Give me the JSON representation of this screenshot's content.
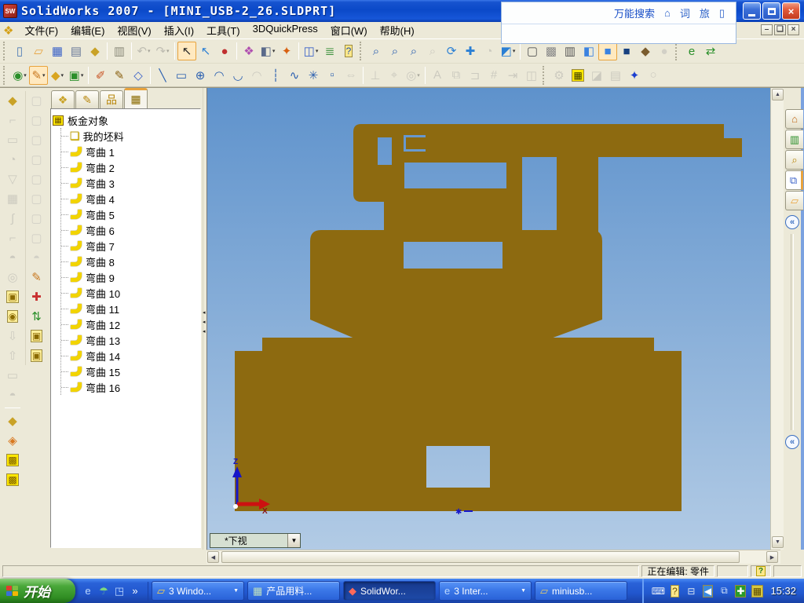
{
  "window": {
    "title": "SolidWorks 2007 - [MINI_USB-2_26.SLDPRT]",
    "close_glyph": "×",
    "mdi_min": "–",
    "mdi_restore": "❏",
    "mdi_close": "×"
  },
  "search_overlay": {
    "label": "万能搜索",
    "icons": [
      {
        "n": "home-icon",
        "g": "⌂"
      },
      {
        "n": "dictionary-icon",
        "g": "词"
      },
      {
        "n": "travel-icon",
        "g": "旅"
      },
      {
        "n": "page-icon",
        "g": "▯"
      }
    ]
  },
  "menu_bar": {
    "items": [
      "文件(F)",
      "编辑(E)",
      "视图(V)",
      "插入(I)",
      "工具(T)",
      "3DQuickPress",
      "窗口(W)",
      "帮助(H)"
    ]
  },
  "toolbars": {
    "row1": [
      {
        "grip": true
      },
      {
        "n": "new-doc-icon",
        "g": "▯",
        "c": "#4a7ab5"
      },
      {
        "n": "open-icon",
        "g": "▱",
        "c": "#e8a33d"
      },
      {
        "n": "save-icon",
        "g": "▦",
        "c": "#3b62c8"
      },
      {
        "n": "make-drawing-icon",
        "g": "▤",
        "c": "#6a7a9a"
      },
      {
        "n": "sw-explorer-icon",
        "g": "◆",
        "c": "#c9a227"
      },
      {
        "sep": true
      },
      {
        "n": "print-icon",
        "g": "▥",
        "c": "#8a8a7a"
      },
      {
        "sep": true
      },
      {
        "n": "undo-icon",
        "g": "↶",
        "c": "#777",
        "dis": true,
        "dd": true
      },
      {
        "n": "redo-icon",
        "g": "↷",
        "c": "#777",
        "dis": true,
        "dd": true
      },
      {
        "sep": true
      },
      {
        "n": "select-icon",
        "g": "↖",
        "c": "#222",
        "pr": true
      },
      {
        "n": "select-filter-icon",
        "g": "↖",
        "c": "#2a7fd4"
      },
      {
        "n": "filter-toggle-icon",
        "g": "●",
        "c": "#c03030"
      },
      {
        "sep": true
      },
      {
        "n": "color-swatch-icon",
        "g": "❖",
        "c": "#b050b0"
      },
      {
        "n": "section-view-icon",
        "g": "◧",
        "c": "#5a6a8a",
        "dd": true
      },
      {
        "n": "photoworks-icon",
        "g": "✦",
        "c": "#d86010"
      },
      {
        "sep": true
      },
      {
        "n": "window-split-icon",
        "g": "◫",
        "c": "#3b62c8",
        "dd": true
      },
      {
        "n": "options-icon",
        "g": "≣",
        "c": "#3a8f3a"
      },
      {
        "n": "help-icon",
        "g": "?",
        "c": "#1a50b0",
        "bg": "#ffe88a"
      },
      {
        "grip": true
      },
      {
        "n": "zoom-select-icon",
        "g": "⌕",
        "c": "#2a5fb0"
      },
      {
        "n": "zoom-fit-icon",
        "g": "⌕",
        "c": "#2a5fb0"
      },
      {
        "n": "zoom-area-icon",
        "g": "⌕",
        "c": "#2a5fb0"
      },
      {
        "n": "zoom-inout-icon",
        "g": "⌕",
        "c": "#999",
        "dis": true
      },
      {
        "n": "rotate-view-icon",
        "g": "⟳",
        "c": "#2a7fd4"
      },
      {
        "n": "pan-icon",
        "g": "✚",
        "c": "#2a7fd4"
      },
      {
        "n": "previous-view-icon",
        "g": "◔",
        "c": "#999",
        "dis": true
      },
      {
        "n": "view-orientation-icon",
        "g": "◩",
        "c": "#2a7fd4",
        "dd": true
      },
      {
        "sep": true
      },
      {
        "n": "wireframe-icon",
        "g": "▢",
        "c": "#555"
      },
      {
        "n": "hidden-lines-visible-icon",
        "g": "▩",
        "c": "#888"
      },
      {
        "n": "hidden-lines-removed-icon",
        "g": "▥",
        "c": "#555"
      },
      {
        "n": "shaded-with-edges-icon",
        "g": "◧",
        "c": "#3b82e0"
      },
      {
        "n": "shaded-icon",
        "g": "■",
        "c": "#3b82e0",
        "pr": true
      },
      {
        "n": "shadows-icon",
        "g": "■",
        "c": "#17407f"
      },
      {
        "n": "realview-icon",
        "g": "◆",
        "c": "#7a5c2e"
      },
      {
        "n": "perspective-icon",
        "g": "●",
        "c": "#aaa",
        "dis": true
      },
      {
        "grip": true
      },
      {
        "n": "edrawings-icon",
        "g": "e",
        "c": "#2a8f2a"
      },
      {
        "n": "sw-tasks-icon",
        "g": "⇄",
        "c": "#2a8f2a"
      }
    ],
    "row2": [
      {
        "grip": true
      },
      {
        "n": "sketch-orbit-icon",
        "g": "◉",
        "c": "#2a8f2a",
        "dd": true
      },
      {
        "n": "sketch-icon",
        "g": "✎",
        "c": "#c87820",
        "pr": true,
        "dd": true
      },
      {
        "n": "reference-plane-icon",
        "g": "◆",
        "c": "#d9a520",
        "dd": true
      },
      {
        "n": "extrude-icon",
        "g": "▣",
        "c": "#2a8f2a",
        "dd": true
      },
      {
        "sep": true
      },
      {
        "n": "sketch-2d-icon",
        "g": "✐",
        "c": "#c85020"
      },
      {
        "n": "sketch-3d-icon",
        "g": "✎",
        "c": "#8a6010"
      },
      {
        "n": "modify-sketch-icon",
        "g": "◇",
        "c": "#3b62c8"
      },
      {
        "sep": true
      },
      {
        "n": "line-icon",
        "g": "╲",
        "c": "#2a5fb0"
      },
      {
        "n": "rectangle-icon",
        "g": "▭",
        "c": "#2a5fb0"
      },
      {
        "n": "circle-icon",
        "g": "⊕",
        "c": "#2a5fb0"
      },
      {
        "n": "centerpoint-arc-icon",
        "g": "◠",
        "c": "#2a5fb0"
      },
      {
        "n": "tangent-arc-icon",
        "g": "◡",
        "c": "#2a5fb0"
      },
      {
        "n": "three-point-arc-icon",
        "g": "◠",
        "c": "#999",
        "dis": true
      },
      {
        "n": "centerline-icon",
        "g": "┆",
        "c": "#2a5fb0"
      },
      {
        "n": "spline-icon",
        "g": "∿",
        "c": "#2a5fb0"
      },
      {
        "n": "point-icon",
        "g": "✳",
        "c": "#2a5fb0"
      },
      {
        "n": "hatch-icon",
        "g": "▫",
        "c": "#2a5fb0"
      },
      {
        "n": "dynamic-mirror-icon",
        "g": "⇔",
        "c": "#999",
        "dis": true
      },
      {
        "sep": true
      },
      {
        "n": "perpendicular-icon",
        "g": "⊥",
        "c": "#999",
        "dis": true
      },
      {
        "n": "smart-dimension-icon",
        "g": "⌖",
        "c": "#999",
        "dis": true
      },
      {
        "n": "circular-pattern-icon",
        "g": "◎",
        "c": "#999",
        "dis": true,
        "dd": true
      },
      {
        "sep": true
      },
      {
        "n": "text-icon",
        "g": "A",
        "c": "#999",
        "dis": true
      },
      {
        "n": "convert-entities-icon",
        "g": "⧉",
        "c": "#999",
        "dis": true
      },
      {
        "n": "offset-entities-icon",
        "g": "⊐",
        "c": "#999",
        "dis": true
      },
      {
        "n": "trim-entities-icon",
        "g": "#",
        "c": "#999",
        "dis": true
      },
      {
        "n": "extend-entities-icon",
        "g": "⇥",
        "c": "#999",
        "dis": true
      },
      {
        "n": "mirror-entities-icon",
        "g": "◫",
        "c": "#999",
        "dis": true
      },
      {
        "grip": true
      },
      {
        "n": "qp-die-set-icon",
        "g": "⚙",
        "c": "#999",
        "dis": true
      },
      {
        "n": "qp-strip-layout-icon",
        "g": "▦",
        "c": "#3a3a00",
        "bg": "#ffe800"
      },
      {
        "n": "qp-punch-icon",
        "g": "◪",
        "c": "#999",
        "dis": true
      },
      {
        "n": "qp-die-plate-icon",
        "g": "▤",
        "c": "#999",
        "dis": true
      },
      {
        "n": "qp-tooling-icon",
        "g": "✦",
        "c": "#1b3fd0"
      },
      {
        "n": "qp-preview-icon",
        "g": "○",
        "c": "#999",
        "dis": true
      }
    ],
    "left_col1": [
      {
        "n": "qp-blank-book-icon",
        "g": "◆",
        "c": "#c9a227"
      },
      {
        "n": "bend-tool-icon",
        "g": "⌐",
        "c": "#999",
        "dis": true
      },
      {
        "n": "flatten-tool-icon",
        "g": "▭",
        "c": "#999",
        "dis": true
      },
      {
        "n": "curl-tool-icon",
        "g": "◔",
        "c": "#999",
        "dis": true
      },
      {
        "n": "vee-bend-icon",
        "g": "▽",
        "c": "#999",
        "dis": true
      },
      {
        "n": "form-grid-icon",
        "g": "▦",
        "c": "#999",
        "dis": true
      },
      {
        "n": "s-bend-icon",
        "g": "∫",
        "c": "#999",
        "dis": true
      },
      {
        "n": "step-bend-icon",
        "g": "⌐",
        "c": "#999",
        "dis": true
      },
      {
        "n": "dome-tool-icon",
        "g": "◓",
        "c": "#999",
        "dis": true
      },
      {
        "n": "pierce-tool-icon",
        "g": "◎",
        "c": "#999",
        "dis": true
      },
      {
        "n": "unfold-all-icon",
        "g": "▣",
        "c": "#8a6a00",
        "bg": "#ffef9a"
      },
      {
        "n": "fold-all-icon",
        "g": "◉",
        "c": "#8a6a00",
        "bg": "#ffef9a"
      },
      {
        "n": "move-down-icon",
        "g": "⇩",
        "c": "#999",
        "dis": true
      },
      {
        "n": "move-up-icon",
        "g": "⇧",
        "c": "#999",
        "dis": true
      },
      {
        "n": "flat-pattern-icon",
        "g": "▭",
        "c": "#999",
        "dis": true
      },
      {
        "n": "dome-2-icon",
        "g": "◓",
        "c": "#999",
        "dis": true
      },
      {
        "sep": true
      },
      {
        "n": "blank-book-icon",
        "g": "◆",
        "c": "#c9a227"
      },
      {
        "n": "unfold-step-icon",
        "g": "◈",
        "c": "#d87820"
      },
      {
        "n": "strip-grid-icon",
        "g": "▩",
        "c": "#7a5c00",
        "bg": "#ffe800"
      },
      {
        "n": "strip-grid-2-icon",
        "g": "▩",
        "c": "#7a5c00",
        "bg": "#ffe800"
      }
    ],
    "left_col2": [
      {
        "n": "view-cube-1-icon",
        "g": "▢",
        "c": "#aaa",
        "dis": true
      },
      {
        "n": "view-cube-2-icon",
        "g": "▢",
        "c": "#aaa",
        "dis": true
      },
      {
        "n": "view-cube-3-icon",
        "g": "▢",
        "c": "#aaa",
        "dis": true
      },
      {
        "n": "view-cube-4-icon",
        "g": "▢",
        "c": "#aaa",
        "dis": true
      },
      {
        "n": "view-cube-5-icon",
        "g": "▢",
        "c": "#aaa",
        "dis": true
      },
      {
        "n": "view-cube-6-icon",
        "g": "▢",
        "c": "#aaa",
        "dis": true
      },
      {
        "n": "view-cube-7-icon",
        "g": "▢",
        "c": "#aaa",
        "dis": true
      },
      {
        "n": "view-cube-8-icon",
        "g": "▢",
        "c": "#aaa",
        "dis": true
      },
      {
        "n": "round-cube-icon",
        "g": "◓",
        "c": "#aaa",
        "dis": true
      },
      {
        "n": "new-sketch-icon",
        "g": "✎",
        "c": "#c87820"
      },
      {
        "n": "add-point-icon",
        "g": "✚",
        "c": "#c83030"
      },
      {
        "n": "process-flow-icon",
        "g": "⇅",
        "c": "#2a8f2a"
      },
      {
        "n": "die-block-1-icon",
        "g": "▣",
        "c": "#8a6a00",
        "bg": "#ffef9a"
      },
      {
        "n": "die-block-2-icon",
        "g": "▣",
        "c": "#8a6a00",
        "bg": "#ffef9a"
      }
    ]
  },
  "feature_panel": {
    "tabs": [
      {
        "n": "featuremanager-tab",
        "g": "❖",
        "c": "#c9a227"
      },
      {
        "n": "propertymanager-tab",
        "g": "✎",
        "c": "#b8860b"
      },
      {
        "n": "configurationmanager-tab",
        "g": "品",
        "c": "#b8860b"
      },
      {
        "n": "sheetmetal-manager-tab",
        "g": "▦",
        "c": "#8a6a00",
        "pr": true
      }
    ],
    "root": "板金对象",
    "blank": "我的坯料",
    "bends": [
      "弯曲 1",
      "弯曲 2",
      "弯曲 3",
      "弯曲 4",
      "弯曲 5",
      "弯曲 6",
      "弯曲 7",
      "弯曲 8",
      "弯曲 9",
      "弯曲 10",
      "弯曲 11",
      "弯曲 12",
      "弯曲 13",
      "弯曲 14",
      "弯曲 15",
      "弯曲 16"
    ]
  },
  "viewport": {
    "view_selector": "*下视",
    "dropdown_glyph": "▼",
    "triad": {
      "x": "X",
      "z": "Z"
    }
  },
  "taskpane": {
    "tabs": [
      {
        "n": "sw-resources-tab",
        "g": "⌂",
        "c": "#c06818"
      },
      {
        "n": "design-library-tab",
        "g": "▥",
        "c": "#2a8f2a"
      },
      {
        "n": "file-explorer-tab",
        "g": "⌕",
        "c": "#b8860b"
      },
      {
        "n": "view-palette-tab",
        "g": "⧉",
        "c": "#3b62c8",
        "pr": true
      },
      {
        "n": "appearances-tab",
        "g": "▱",
        "c": "#e8a33d"
      }
    ],
    "collapse_glyph": "«"
  },
  "status_bar": {
    "editing_label": "正在编辑: 零件",
    "help_glyph": "?"
  },
  "taskbar": {
    "start_label": "开始",
    "quick_launch": [
      {
        "n": "ie-quicklaunch-icon",
        "g": "e",
        "c": "#bcd8ff"
      },
      {
        "n": "antivirus-quicklaunch-icon",
        "g": "☂",
        "c": "#7ed87e"
      },
      {
        "n": "desktop-quicklaunch-icon",
        "g": "◳",
        "c": "#bcd8ff"
      },
      {
        "n": "chevron-icon",
        "g": "»",
        "c": "#ffffff"
      }
    ],
    "tasks": [
      {
        "n": "task-windows-group",
        "icon_g": "▱",
        "icon_c": "#ffd24a",
        "label": "3 Windo...",
        "dropdown": true
      },
      {
        "n": "task-materials-doc",
        "icon_g": "▦",
        "icon_c": "#bfe0bf",
        "label": "产品用料..."
      },
      {
        "n": "task-solidworks",
        "icon_g": "◆",
        "icon_c": "#ff6a5a",
        "label": "SolidWor...",
        "active": true
      },
      {
        "n": "task-internet-group",
        "icon_g": "e",
        "icon_c": "#bcd8ff",
        "label": "3 Inter...",
        "dropdown": true
      },
      {
        "n": "task-miniusb",
        "icon_g": "▱",
        "icon_c": "#e8cc6a",
        "label": "miniusb..."
      }
    ],
    "tray": [
      {
        "n": "keyboard-tray-icon",
        "g": "⌨",
        "c": "#e8eef8"
      },
      {
        "n": "help-tray-icon",
        "g": "?",
        "c": "#6a5200",
        "bg": "#ffe88a"
      },
      {
        "n": "safely-remove-icon",
        "g": "⊟",
        "c": "#d8e4f4"
      },
      {
        "n": "tray-collapse-icon",
        "g": "◀",
        "c": "#ffffff",
        "bg": "#3a8ae0"
      },
      {
        "n": "network-tray-icon",
        "g": "⧉",
        "c": "#cfe0f8"
      },
      {
        "n": "security-shield-icon",
        "g": "✚",
        "c": "#ffffff",
        "bg": "#2a9a2a"
      },
      {
        "n": "language-bar-icon",
        "g": "▦",
        "c": "#5a4a00",
        "bg": "#d8c840"
      }
    ],
    "time": "15:32"
  },
  "colors": {
    "part": "#8D6A10",
    "viewport_top": "#5E92CC",
    "viewport_bottom": "#B2CBE5",
    "triad_x": "#CC1111",
    "triad_z": "#1515C8"
  }
}
